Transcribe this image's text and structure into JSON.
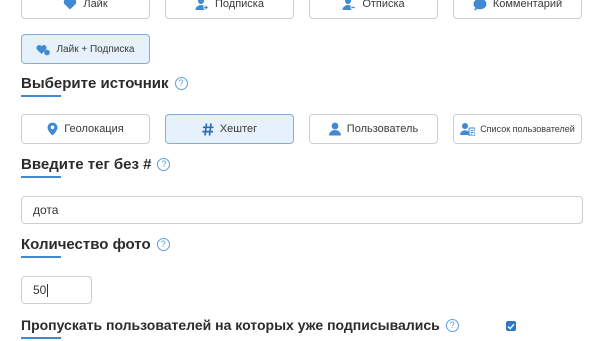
{
  "action_buttons": {
    "like": "Лайк",
    "follow": "Подписка",
    "unfollow": "Отписка",
    "comment": "Комментарий",
    "like_follow": "Лайк + Подписка"
  },
  "source_section": {
    "title": "Выберите источник",
    "help": "?",
    "options": {
      "geo": "Геолокация",
      "hashtag": "Хештег",
      "user": "Пользователь",
      "user_list": "Список пользователей"
    },
    "selected": "hashtag"
  },
  "tag_section": {
    "title": "Введите тег без #",
    "help": "?",
    "value": "дота"
  },
  "count_section": {
    "title": "Количество фото",
    "help": "?",
    "value": "50"
  },
  "skip_section": {
    "title": "Пропускать пользователей на которых уже подписывались",
    "help": "?",
    "checked": true
  },
  "colors": {
    "accent": "#3f8ad3",
    "active_bg": "#e6f1fb"
  }
}
